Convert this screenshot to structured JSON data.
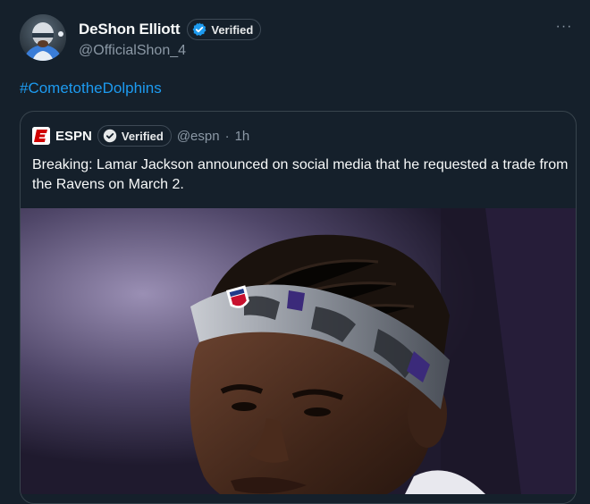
{
  "tweet": {
    "author": {
      "display_name": "DeShon Elliott",
      "handle": "@OfficialShon_4",
      "verified_label": "Verified",
      "avatar_icon": "player-avatar"
    },
    "more_icon": "more-dots-icon",
    "more_glyph": "···",
    "hashtag": "#CometotheDolphins",
    "quoted": {
      "author_name": "ESPN",
      "verified_label": "Verified",
      "handle": "@espn",
      "separator": "·",
      "time": "1h",
      "text": "Breaking: Lamar Jackson announced on social media that he requested a trade from the Ravens on March 2.",
      "logo_icon": "espn-logo-icon",
      "image_icon": "player-photo"
    }
  },
  "colors": {
    "background": "#15202b",
    "link": "#1d9bf0",
    "secondary_text": "#8b98a5",
    "verified_badge": "#1d9bf0",
    "border": "#38444d",
    "espn_red": "#d00000"
  }
}
